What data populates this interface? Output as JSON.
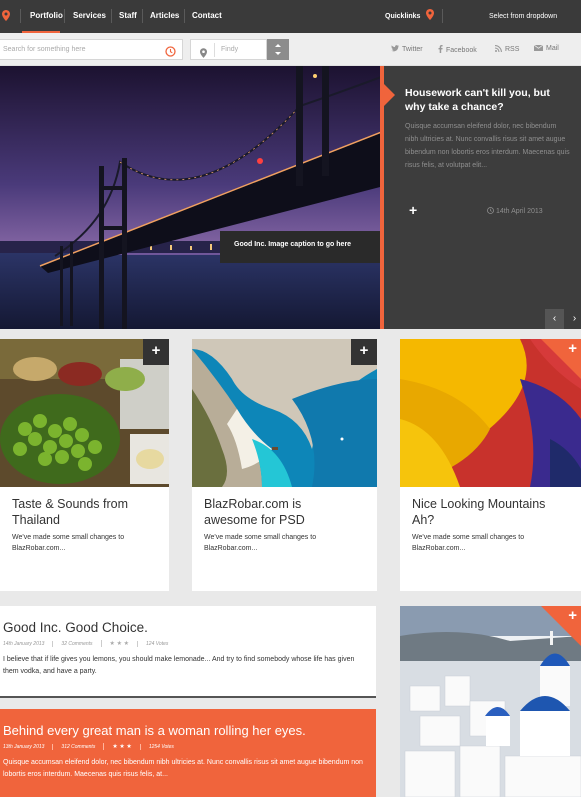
{
  "nav": {
    "items": [
      "Portfolio",
      "Services",
      "Staff",
      "Articles",
      "Contact"
    ],
    "active": "Portfolio",
    "quicklinks": "Quicklinks",
    "dropdown": "Select from dropdown"
  },
  "search": {
    "placeholder": "Search for something here",
    "location_placeholder": "Findy"
  },
  "social": {
    "twitter": "Twitter",
    "facebook": "Facebook",
    "rss": "RSS",
    "mail": "Mail"
  },
  "hero": {
    "caption": "Good Inc. Image caption to go here"
  },
  "feature": {
    "title": "Housework can't kill you, but why take a chance?",
    "excerpt": "Quisque accumsan eleifend dolor, nec bibendum nibh ultricies at. Nunc convallis risus sit amet augue bibendum non lobortis eros interdum. Maecenas quis risus felis, at volutpat elit...",
    "plus": "+",
    "date": "14th April 2013",
    "prev": "‹",
    "next": "›"
  },
  "cards": [
    {
      "title": "Taste & Sounds from Thailand",
      "text": "We've made some small changes to BlazRobar.com...",
      "plus": "+"
    },
    {
      "title": "BlazRobar.com is awesome for PSD",
      "text": "We've made some small changes to BlazRobar.com...",
      "plus": "+"
    },
    {
      "title": "Nice Looking Mountains Ah?",
      "text": "We've made some small changes to BlazRobar.com...",
      "plus": "+"
    }
  ],
  "posts": [
    {
      "title": "Good Inc. Good Choice.",
      "date": "14th January 2013",
      "comments": "32 Comments",
      "stars": "★ ★ ★",
      "votes": "124 Votes",
      "text": "I believe that if life gives you lemons, you should make lemonade... And try to find somebody whose life has given them vodka, and have a party."
    },
    {
      "title": "Behind every great man is a woman rolling her eyes.",
      "date": "13th January 2013",
      "comments": "312 Comments",
      "stars": "★ ★ ★",
      "votes": "1254 Votes",
      "text": "Quisque accumsan eleifend dolor, nec bibendum nibh ultricies at. Nunc convallis risus sit amet augue bibendum non lobortis eros interdum. Maecenas quis risus felis, at..."
    }
  ],
  "santorini": {
    "plus": "+"
  },
  "colors": {
    "accent": "#f0643c",
    "dark": "#3a3a3a",
    "panel": "#3d3d3d"
  }
}
